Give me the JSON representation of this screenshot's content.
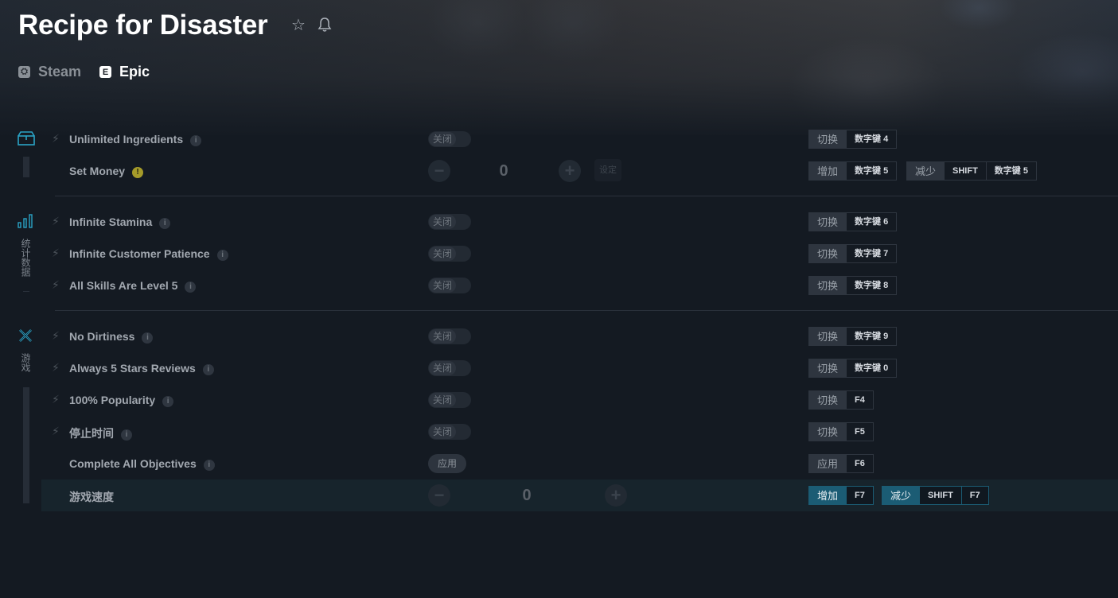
{
  "game": {
    "title": "Recipe for Disaster",
    "platforms": [
      {
        "label": "Steam",
        "icon": "steam-icon",
        "badge": "⛭"
      },
      {
        "label": "Epic",
        "icon": "epic-games-icon",
        "badge": "E"
      }
    ]
  },
  "sidebar": {
    "stats_label": "统计数据",
    "game_label": "游戏"
  },
  "cheats": [
    {
      "name": "Unlimited Ingredients",
      "control": "关闭",
      "hotkeys": [
        {
          "action": "切换",
          "keys": [
            "数字键 4"
          ]
        }
      ]
    },
    {
      "name": "Set Money",
      "value": "0",
      "set_label": "设定",
      "hotkeys": [
        {
          "action": "增加",
          "keys": [
            "数字键 5"
          ]
        },
        {
          "action": "减少",
          "keys": [
            "SHIFT",
            "数字键 5"
          ]
        }
      ]
    },
    {
      "name": "Infinite Stamina",
      "control": "关闭",
      "hotkeys": [
        {
          "action": "切换",
          "keys": [
            "数字键 6"
          ]
        }
      ]
    },
    {
      "name": "Infinite Customer Patience",
      "control": "关闭",
      "hotkeys": [
        {
          "action": "切换",
          "keys": [
            "数字键 7"
          ]
        }
      ]
    },
    {
      "name": "All Skills Are Level 5",
      "control": "关闭",
      "hotkeys": [
        {
          "action": "切换",
          "keys": [
            "数字键 8"
          ]
        }
      ]
    },
    {
      "name": "No Dirtiness",
      "control": "关闭",
      "hotkeys": [
        {
          "action": "切换",
          "keys": [
            "数字键 9"
          ]
        }
      ]
    },
    {
      "name": "Always 5 Stars Reviews",
      "control": "关闭",
      "hotkeys": [
        {
          "action": "切换",
          "keys": [
            "数字键 0"
          ]
        }
      ]
    },
    {
      "name": "100% Popularity",
      "control": "关闭",
      "hotkeys": [
        {
          "action": "切换",
          "keys": [
            "F4"
          ]
        }
      ]
    },
    {
      "name": "停止时间",
      "control": "关闭",
      "hotkeys": [
        {
          "action": "切换",
          "keys": [
            "F5"
          ]
        }
      ]
    },
    {
      "name": "Complete All Objectives",
      "control": "应用",
      "hotkeys": [
        {
          "action": "应用",
          "keys": [
            "F6"
          ]
        }
      ]
    },
    {
      "name": "游戏速度",
      "value": "0",
      "hotkeys": [
        {
          "action": "增加",
          "keys": [
            "F7"
          ]
        },
        {
          "action": "减少",
          "keys": [
            "SHIFT",
            "F7"
          ]
        }
      ]
    }
  ]
}
